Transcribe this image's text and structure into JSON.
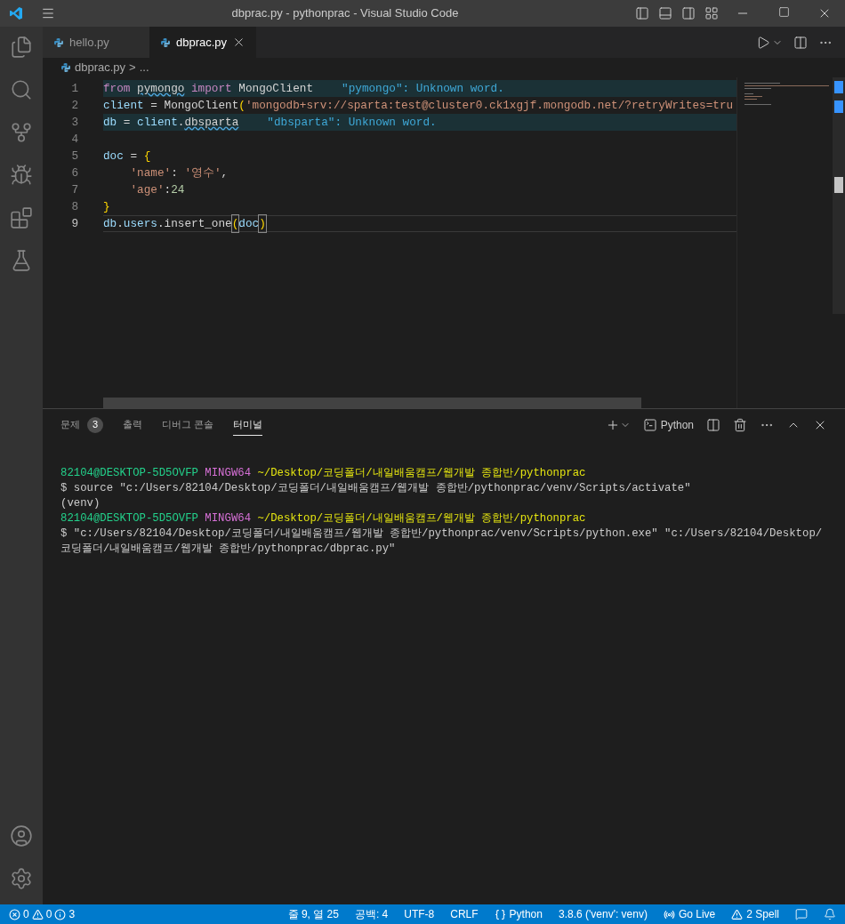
{
  "window": {
    "title": "dbprac.py - pythonprac - Visual Studio Code"
  },
  "tabs": [
    {
      "label": "hello.py",
      "selected": false
    },
    {
      "label": "dbprac.py",
      "selected": true
    }
  ],
  "breadcrumb": [
    "dbprac.py",
    ">",
    "..."
  ],
  "editor": {
    "lines": [
      {
        "number": "1",
        "highlighted": true,
        "current": false,
        "hint": "\"pymongo\": Unknown word.",
        "tokens": [
          {
            "text": "from ",
            "kind": "keyword"
          },
          {
            "text": "pymongo",
            "kind": "misspelled"
          },
          {
            "text": " import",
            "kind": "keyword"
          },
          {
            "text": " MongoClient",
            "kind": "plain"
          }
        ]
      },
      {
        "number": "2",
        "highlighted": false,
        "current": false,
        "tokens": [
          {
            "text": "client",
            "kind": "variable"
          },
          {
            "text": " = ",
            "kind": "plain"
          },
          {
            "text": "MongoClient",
            "kind": "plain"
          },
          {
            "text": "(",
            "kind": "bracket"
          },
          {
            "text": "'mongodb+srv://sparta:test@cluster0.ck1xgjf.mongodb.net/?retryWrites=tru",
            "kind": "string"
          }
        ]
      },
      {
        "number": "3",
        "highlighted": true,
        "current": false,
        "hint": "\"dbsparta\": Unknown word.",
        "tokens": [
          {
            "text": "db",
            "kind": "variable"
          },
          {
            "text": " = ",
            "kind": "plain"
          },
          {
            "text": "client",
            "kind": "variable"
          },
          {
            "text": ".",
            "kind": "plain"
          },
          {
            "text": "dbsparta",
            "kind": "misspelled"
          }
        ]
      },
      {
        "number": "4",
        "highlighted": false,
        "current": false
      },
      {
        "number": "5",
        "highlighted": false,
        "current": false,
        "tokens": [
          {
            "text": "doc",
            "kind": "variable"
          },
          {
            "text": " = ",
            "kind": "plain"
          },
          {
            "text": "{",
            "kind": "bracket"
          }
        ]
      },
      {
        "number": "6",
        "highlighted": false,
        "current": false,
        "tokens": [
          {
            "text": "    'name'",
            "kind": "string"
          },
          {
            "text": ": ",
            "kind": "plain"
          },
          {
            "text": "'영수'",
            "kind": "string"
          },
          {
            "text": ",",
            "kind": "plain"
          }
        ]
      },
      {
        "number": "7",
        "highlighted": false,
        "current": false,
        "tokens": [
          {
            "text": "    'age'",
            "kind": "string"
          },
          {
            "text": ":",
            "kind": "plain"
          },
          {
            "text": "24",
            "kind": "number"
          }
        ]
      },
      {
        "number": "8",
        "highlighted": false,
        "current": false,
        "tokens": [
          {
            "text": "}",
            "kind": "bracket"
          }
        ]
      },
      {
        "number": "9",
        "highlighted": false,
        "current": true,
        "tokens": [
          {
            "text": "db",
            "kind": "variable"
          },
          {
            "text": ".",
            "kind": "plain"
          },
          {
            "text": "users",
            "kind": "variable"
          },
          {
            "text": ".",
            "kind": "plain"
          },
          {
            "text": "insert_one",
            "kind": "plain"
          },
          {
            "text": "(",
            "kind": "matched"
          },
          {
            "text": "doc",
            "kind": "variable"
          },
          {
            "text": ")",
            "kind": "matched"
          }
        ]
      }
    ]
  },
  "panel": {
    "tabs": [
      {
        "label": "문제",
        "badge": "3",
        "selected": false
      },
      {
        "label": "출력",
        "selected": false
      },
      {
        "label": "디버그 콘솔",
        "selected": false
      },
      {
        "label": "터미널",
        "selected": true
      }
    ],
    "terminal_name": "Python",
    "terminal": [
      [
        {
          "text": "82104@DESKTOP-5D5OVFP ",
          "kind": "user"
        },
        {
          "text": "MINGW64",
          "kind": "host"
        },
        {
          "text": " ~/Desktop/코딩폴더/내일배움캠프/웹개발 종합반/pythonprac",
          "kind": "path"
        }
      ],
      [
        {
          "text": "$ source \"c:/Users/82104/Desktop/코딩폴더/내일배움캠프/웹개발 종합반/pythonprac/venv/Scripts/activate\"",
          "kind": "plain"
        }
      ],
      [
        {
          "text": "(venv)",
          "kind": "plain"
        }
      ],
      [
        {
          "text": "82104@DESKTOP-5D5OVFP ",
          "kind": "user"
        },
        {
          "text": "MINGW64",
          "kind": "host"
        },
        {
          "text": " ~/Desktop/코딩폴더/내일배움캠프/웹개발 종합반/pythonprac",
          "kind": "path"
        }
      ],
      [
        {
          "text": "$ \"c:/Users/82104/Desktop/코딩폴더/내일배움캠프/웹개발 종합반/pythonprac/venv/Scripts/python.exe\" \"c:/Users/82104/Desktop/",
          "kind": "plain"
        }
      ],
      [
        {
          "text": "코딩폴더/내일배움캠프/웹개발 종합반/pythonprac/dbprac.py\"",
          "kind": "plain"
        }
      ]
    ]
  },
  "status_bar": {
    "errors": "0",
    "warnings": "0",
    "infos": "3",
    "items": [
      {
        "text": "줄 9, 열 25",
        "kind": "text"
      },
      {
        "text": "공백: 4",
        "kind": "text"
      },
      {
        "text": "UTF-8",
        "kind": "text"
      },
      {
        "text": "CRLF",
        "kind": "text"
      },
      {
        "text": "Python",
        "kind": "language"
      },
      {
        "text": "3.8.6 ('venv': venv)",
        "kind": "text"
      },
      {
        "text": "Go Live",
        "kind": "live"
      },
      {
        "text": "2 Spell",
        "kind": "spell"
      }
    ]
  }
}
